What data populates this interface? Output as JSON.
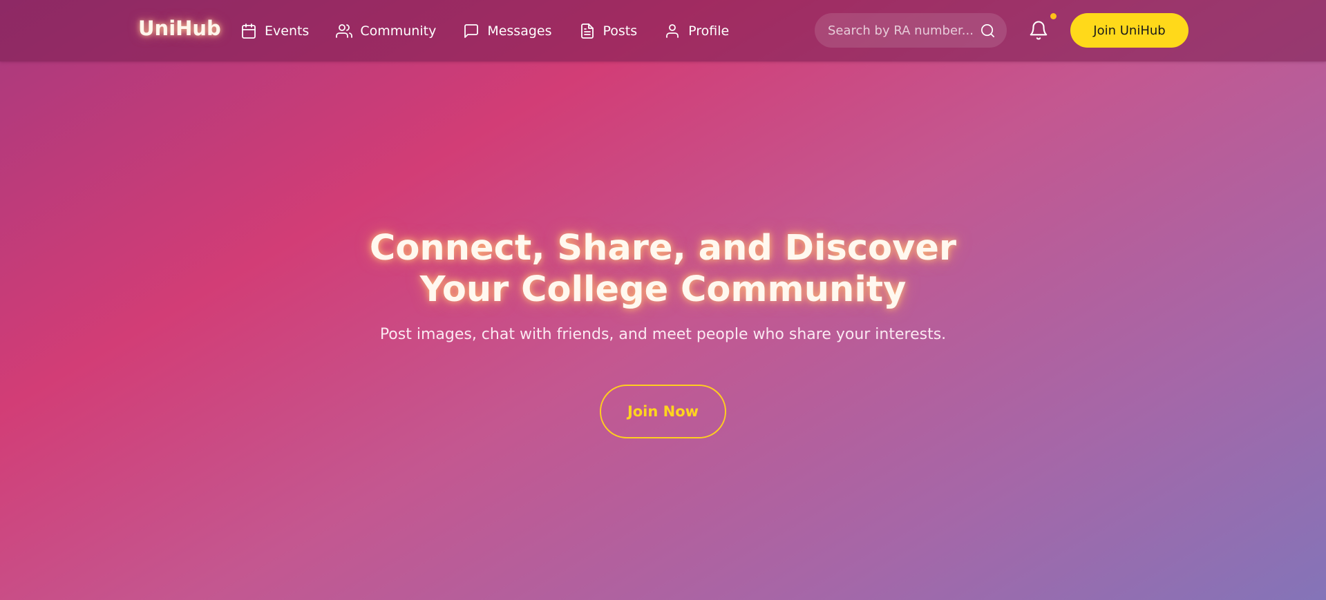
{
  "navbar": {
    "logo": "UniHub",
    "links": [
      {
        "label": "Events",
        "icon": "calendar-icon"
      },
      {
        "label": "Community",
        "icon": "users-icon"
      },
      {
        "label": "Messages",
        "icon": "message-square-icon"
      },
      {
        "label": "Posts",
        "icon": "file-text-icon"
      },
      {
        "label": "Profile",
        "icon": "user-icon"
      }
    ],
    "search": {
      "placeholder": "Search by RA number..."
    },
    "join_button": "Join UniHub"
  },
  "hero": {
    "title_line1": "Connect, Share, and Discover",
    "title_line2": "Your College Community",
    "subtitle": "Post images, chat with friends, and meet people who share your interests.",
    "cta": "Join Now"
  },
  "colors": {
    "accent_yellow": "#ffd91a",
    "notification_dot": "#ffc21a",
    "gradient_pink": "#d23d76",
    "gradient_purple": "#8474b8"
  }
}
